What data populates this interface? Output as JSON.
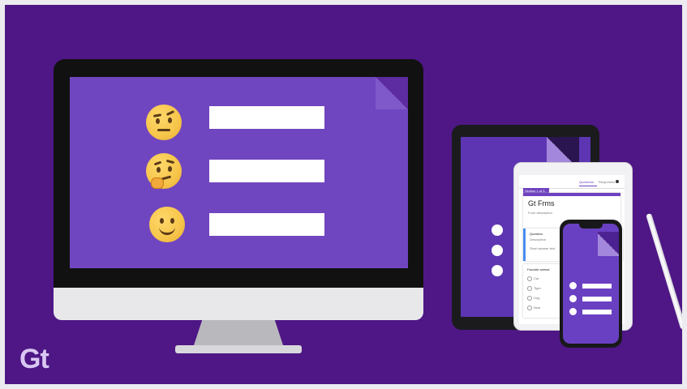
{
  "form": {
    "tabs": [
      "Questions",
      "Responses"
    ],
    "section_label": "Section 1 of 3",
    "title": "Gt Frms",
    "description_placeholder": "Form description",
    "question_label": "Question",
    "question_sub": "Description",
    "short_answer": "Short answer text",
    "favorite_label": "Favorite animal",
    "options": [
      "Cat",
      "Tiger",
      "Dog",
      "Bear"
    ]
  },
  "logo": {
    "text": "Gt"
  },
  "colors": {
    "background": "#4e1785",
    "accent": "#7046c0"
  },
  "icons": {
    "emoji_1": "raised-eyebrow-emoji-icon",
    "emoji_2": "thinking-face-emoji-icon",
    "emoji_3": "slightly-smiling-face-emoji-icon"
  }
}
